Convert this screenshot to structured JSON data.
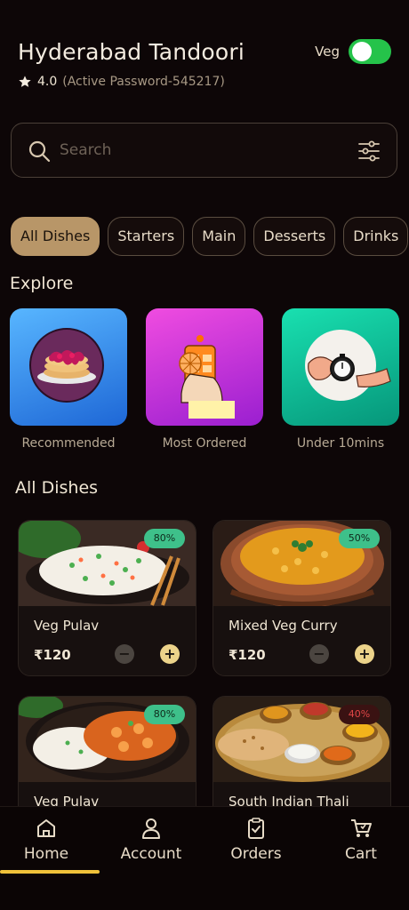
{
  "header": {
    "title": "Hyderabad Tandoori",
    "rating": "4.0",
    "rating_note": "(Active Password-545217)",
    "veg_label": "Veg",
    "veg_enabled": true
  },
  "search": {
    "placeholder": "Search"
  },
  "categories": [
    "All Dishes",
    "Starters",
    "Main",
    "Desserts",
    "Drinks"
  ],
  "active_category": "All Dishes",
  "explore": {
    "title": "Explore",
    "items": [
      {
        "label": "Recommended",
        "icon": "pancake-icon"
      },
      {
        "label": "Most Ordered",
        "icon": "phone-order-icon"
      },
      {
        "label": "Under 10mins",
        "icon": "stopwatch-icon"
      }
    ]
  },
  "dishes": {
    "title": "All Dishes",
    "items": [
      {
        "name": "Veg Pulav",
        "price": "₹120",
        "discount": "80%"
      },
      {
        "name": "Mixed Veg Curry",
        "price": "₹120",
        "discount": "50%"
      },
      {
        "name": "Veg Pulav",
        "price": "",
        "discount": "80%"
      },
      {
        "name": "South Indian Thali",
        "price": "",
        "discount": "40%"
      }
    ]
  },
  "nav": {
    "items": [
      "Home",
      "Account",
      "Orders",
      "Cart"
    ],
    "active": "Home"
  },
  "colors": {
    "background": "#0d0607",
    "accent": "#b89668",
    "toggle_on": "#25c34a",
    "nav_indicator": "#f0c23a"
  }
}
